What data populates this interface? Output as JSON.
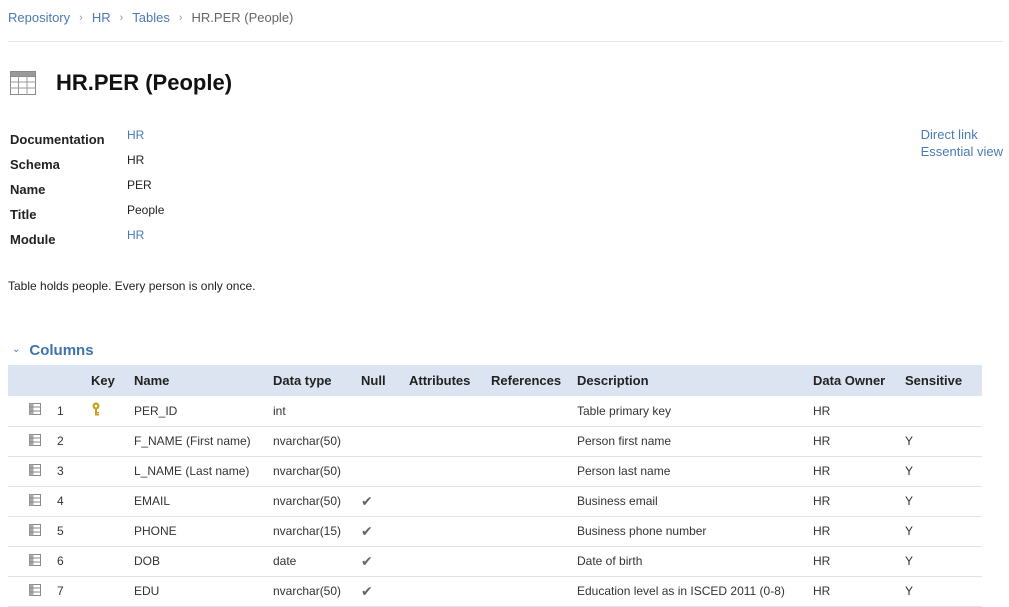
{
  "breadcrumb": {
    "items": [
      "Repository",
      "HR",
      "Tables"
    ],
    "current": "HR.PER (People)"
  },
  "header": {
    "title": "HR.PER (People)",
    "icon": "table-icon"
  },
  "properties": [
    {
      "label": "Documentation",
      "value": "HR",
      "link": true
    },
    {
      "label": "Schema",
      "value": "HR",
      "link": false
    },
    {
      "label": "Name",
      "value": "PER",
      "link": false
    },
    {
      "label": "Title",
      "value": "People",
      "link": false
    },
    {
      "label": "Module",
      "value": "HR",
      "link": true
    }
  ],
  "side_links": {
    "direct_link": "Direct link",
    "essential_view": "Essential view"
  },
  "description": "Table holds people. Every person is only once.",
  "columns_section": {
    "label": "Columns",
    "headers": {
      "key": "Key",
      "name": "Name",
      "data_type": "Data type",
      "null": "Null",
      "attributes": "Attributes",
      "references": "References",
      "description": "Description",
      "data_owner": "Data Owner",
      "sensitive": "Sensitive"
    },
    "rows": [
      {
        "num": "1",
        "key": true,
        "name": "PER_ID",
        "data_type": "int",
        "null": false,
        "attributes": "",
        "references": "",
        "description": "Table primary key",
        "data_owner": "HR",
        "sensitive": ""
      },
      {
        "num": "2",
        "key": false,
        "name": "F_NAME (First name)",
        "data_type": "nvarchar(50)",
        "null": false,
        "attributes": "",
        "references": "",
        "description": "Person first name",
        "data_owner": "HR",
        "sensitive": "Y"
      },
      {
        "num": "3",
        "key": false,
        "name": "L_NAME (Last name)",
        "data_type": "nvarchar(50)",
        "null": false,
        "attributes": "",
        "references": "",
        "description": "Person last name",
        "data_owner": "HR",
        "sensitive": "Y"
      },
      {
        "num": "4",
        "key": false,
        "name": "EMAIL",
        "data_type": "nvarchar(50)",
        "null": true,
        "attributes": "",
        "references": "",
        "description": "Business email",
        "data_owner": "HR",
        "sensitive": "Y"
      },
      {
        "num": "5",
        "key": false,
        "name": "PHONE",
        "data_type": "nvarchar(15)",
        "null": true,
        "attributes": "",
        "references": "",
        "description": "Business phone number",
        "data_owner": "HR",
        "sensitive": "Y"
      },
      {
        "num": "6",
        "key": false,
        "name": "DOB",
        "data_type": "date",
        "null": true,
        "attributes": "",
        "references": "",
        "description": "Date of birth",
        "data_owner": "HR",
        "sensitive": "Y"
      },
      {
        "num": "7",
        "key": false,
        "name": "EDU",
        "data_type": "nvarchar(50)",
        "null": true,
        "attributes": "",
        "references": "",
        "description": "Education level as in ISCED 2011 (0-8)",
        "data_owner": "HR",
        "sensitive": "Y"
      }
    ]
  },
  "colors": {
    "link": "#4a7ab5",
    "section": "#3d74ad",
    "table_header_bg": "#dce4f2",
    "key_icon": "#c8a21a"
  }
}
